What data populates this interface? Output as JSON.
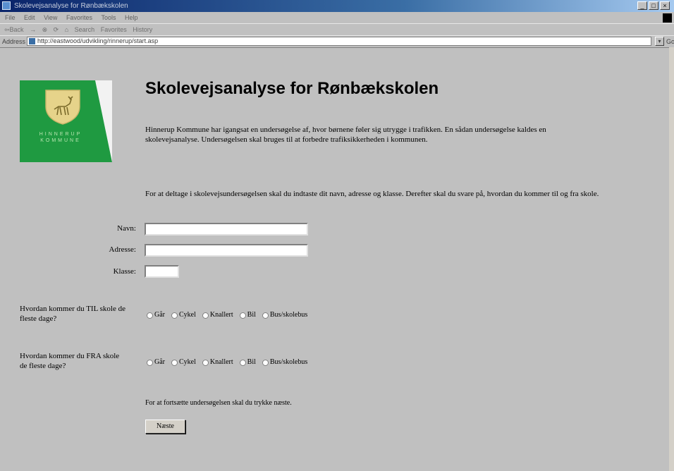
{
  "window": {
    "title": "Skolevejsanalyse for Rønbækskolen",
    "controls": [
      "_",
      "□",
      "×"
    ]
  },
  "menu": [
    "File",
    "Edit",
    "View",
    "Favorites",
    "Tools",
    "Help"
  ],
  "toolbar": [
    "⇦Back",
    "→",
    "⊗",
    "⟳",
    "⌂",
    "Search",
    "Favorites",
    "History"
  ],
  "address": {
    "label": "Address",
    "url": "http://eastwood/udvikling/rinnerup/start.asp",
    "go": "Go"
  },
  "logo": {
    "line1": "HINNERUP",
    "line2": "KOMMUNE",
    "colors": {
      "background": "#1f9a41",
      "shield": "#e6d38a"
    }
  },
  "page": {
    "title": "Skolevejsanalyse for Rønbækskolen",
    "intro": "Hinnerup Kommune har igangsat en undersøgelse af, hvor børnene føler sig utrygge i trafikken. En sådan undersøgelse kaldes en skolevejsanalyse. Undersøgelsen skal bruges til at forbedre trafiksikkerheden i kommunen.",
    "instructions": "For at deltage i skolevejsundersøgelsen skal du indtaste dit navn, adresse og klasse. Derefter skal du svare på, hvordan du kommer til og fra skole."
  },
  "form": {
    "name_label": "Navn:",
    "address_label": "Adresse:",
    "class_label": "Klasse:",
    "name_value": "",
    "address_value": "",
    "class_value": ""
  },
  "questions": {
    "to_school": "Hvordan kommer du TIL skole de fleste dage?",
    "from_school": "Hvordan kommer du FRA skole de fleste dage?",
    "options": [
      "Går",
      "Cykel",
      "Knallert",
      "Bil",
      "Bus/skolebus"
    ]
  },
  "footer": {
    "continue_text": "For at fortsætte undersøgelsen skal du trykke næste.",
    "next_button": "Næste"
  }
}
